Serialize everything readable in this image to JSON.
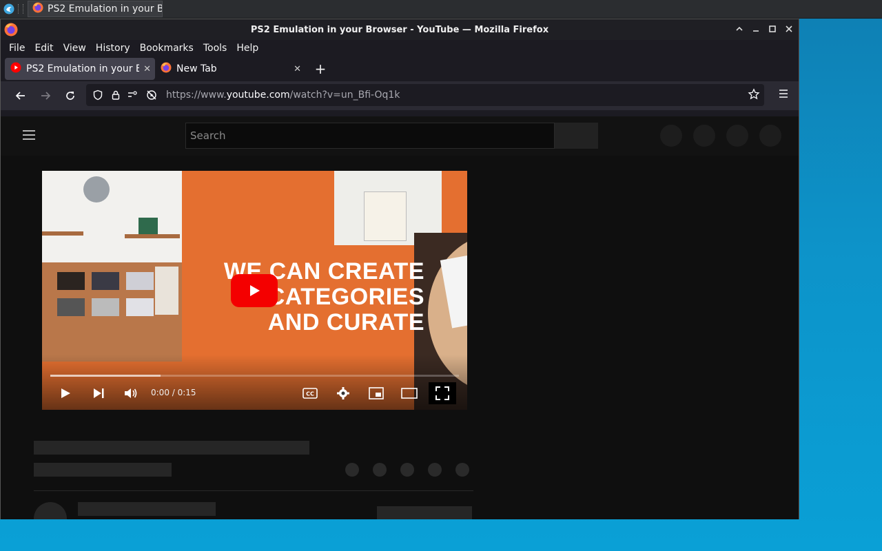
{
  "taskbar": {
    "task_title": "PS2 Emulation in your B..."
  },
  "window": {
    "title": "PS2 Emulation in your Browser - YouTube — Mozilla Firefox"
  },
  "menu": [
    "File",
    "Edit",
    "View",
    "History",
    "Bookmarks",
    "Tools",
    "Help"
  ],
  "tabs": [
    {
      "label": "PS2 Emulation in your Browser - YouTube",
      "active": true
    },
    {
      "label": "New Tab",
      "active": false
    }
  ],
  "url": {
    "scheme": "https://www.",
    "host": "youtube.com",
    "path": "/watch?v=un_Bfi-Oq1k"
  },
  "youtube": {
    "search_placeholder": "Search"
  },
  "video": {
    "overlay_lines": [
      "WE CAN CREATE",
      "CATEGORIES",
      "AND CURATE"
    ],
    "time": "0:00 / 0:15",
    "progress_fraction": 0.27
  },
  "colors": {
    "yt_red": "#f40000",
    "accent": "#e46f30"
  }
}
